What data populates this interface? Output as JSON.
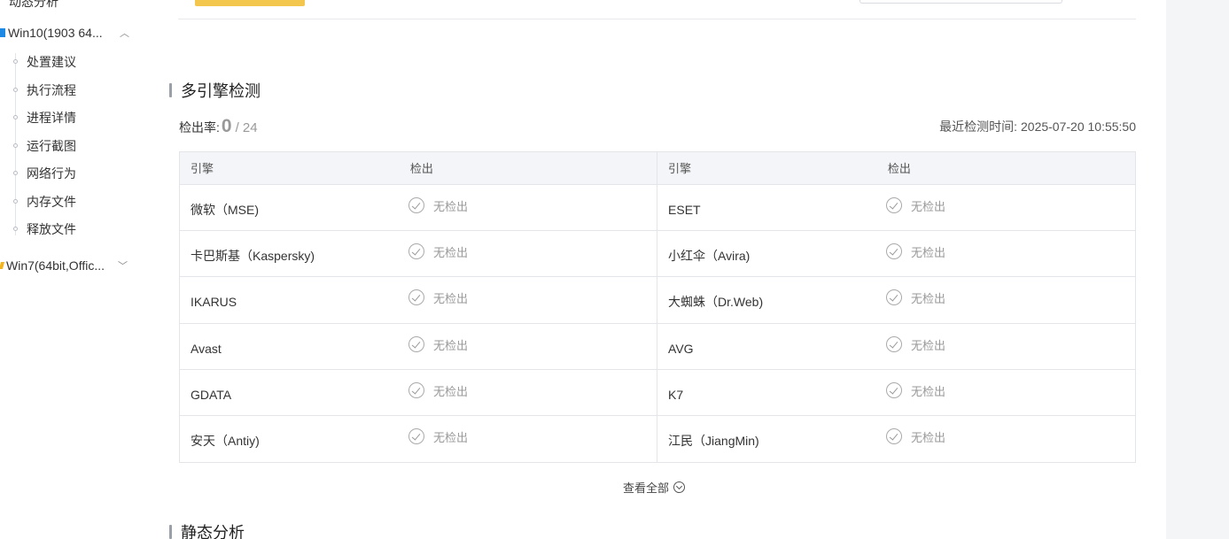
{
  "sidebar": {
    "top_item": "动态分析",
    "groups": [
      {
        "label": "Win10(1903 64...",
        "chevron": "︿",
        "expanded": true
      },
      {
        "label": "Win7(64bit,Offic...",
        "chevron": "﹀",
        "expanded": false
      }
    ],
    "items": [
      "处置建议",
      "执行流程",
      "进程详情",
      "运行截图",
      "网络行为",
      "内存文件",
      "释放文件"
    ]
  },
  "section": {
    "title": "多引擎检测",
    "rate_label": "检出率:",
    "rate_value": "0",
    "rate_total": "/ 24",
    "last_time_label": "最近检测时间:",
    "last_time_value": "2025-07-20 10:55:50"
  },
  "table": {
    "headers": {
      "engine": "引擎",
      "detect": "检出"
    },
    "rows": [
      {
        "left": "微软（MSE)",
        "left_status": "无检出",
        "right": "ESET",
        "right_status": "无检出"
      },
      {
        "left": "卡巴斯基（Kaspersky)",
        "left_status": "无检出",
        "right": "小红伞（Avira)",
        "right_status": "无检出"
      },
      {
        "left": "IKARUS",
        "left_status": "无检出",
        "right": "大蜘蛛（Dr.Web)",
        "right_status": "无检出"
      },
      {
        "left": "Avast",
        "left_status": "无检出",
        "right": "AVG",
        "right_status": "无检出"
      },
      {
        "left": "GDATA",
        "left_status": "无检出",
        "right": "K7",
        "right_status": "无检出"
      },
      {
        "left": "安天（Antiy)",
        "left_status": "无检出",
        "right": "江民（JiangMin)",
        "right_status": "无检出"
      }
    ]
  },
  "view_all": "查看全部",
  "next_section": "静态分析",
  "colors": {
    "accent_button": "#f3c74e",
    "section_bar": "#9aa0a8",
    "win10_icon": "#1e88e5",
    "win7_icon": "#f2b51e"
  }
}
